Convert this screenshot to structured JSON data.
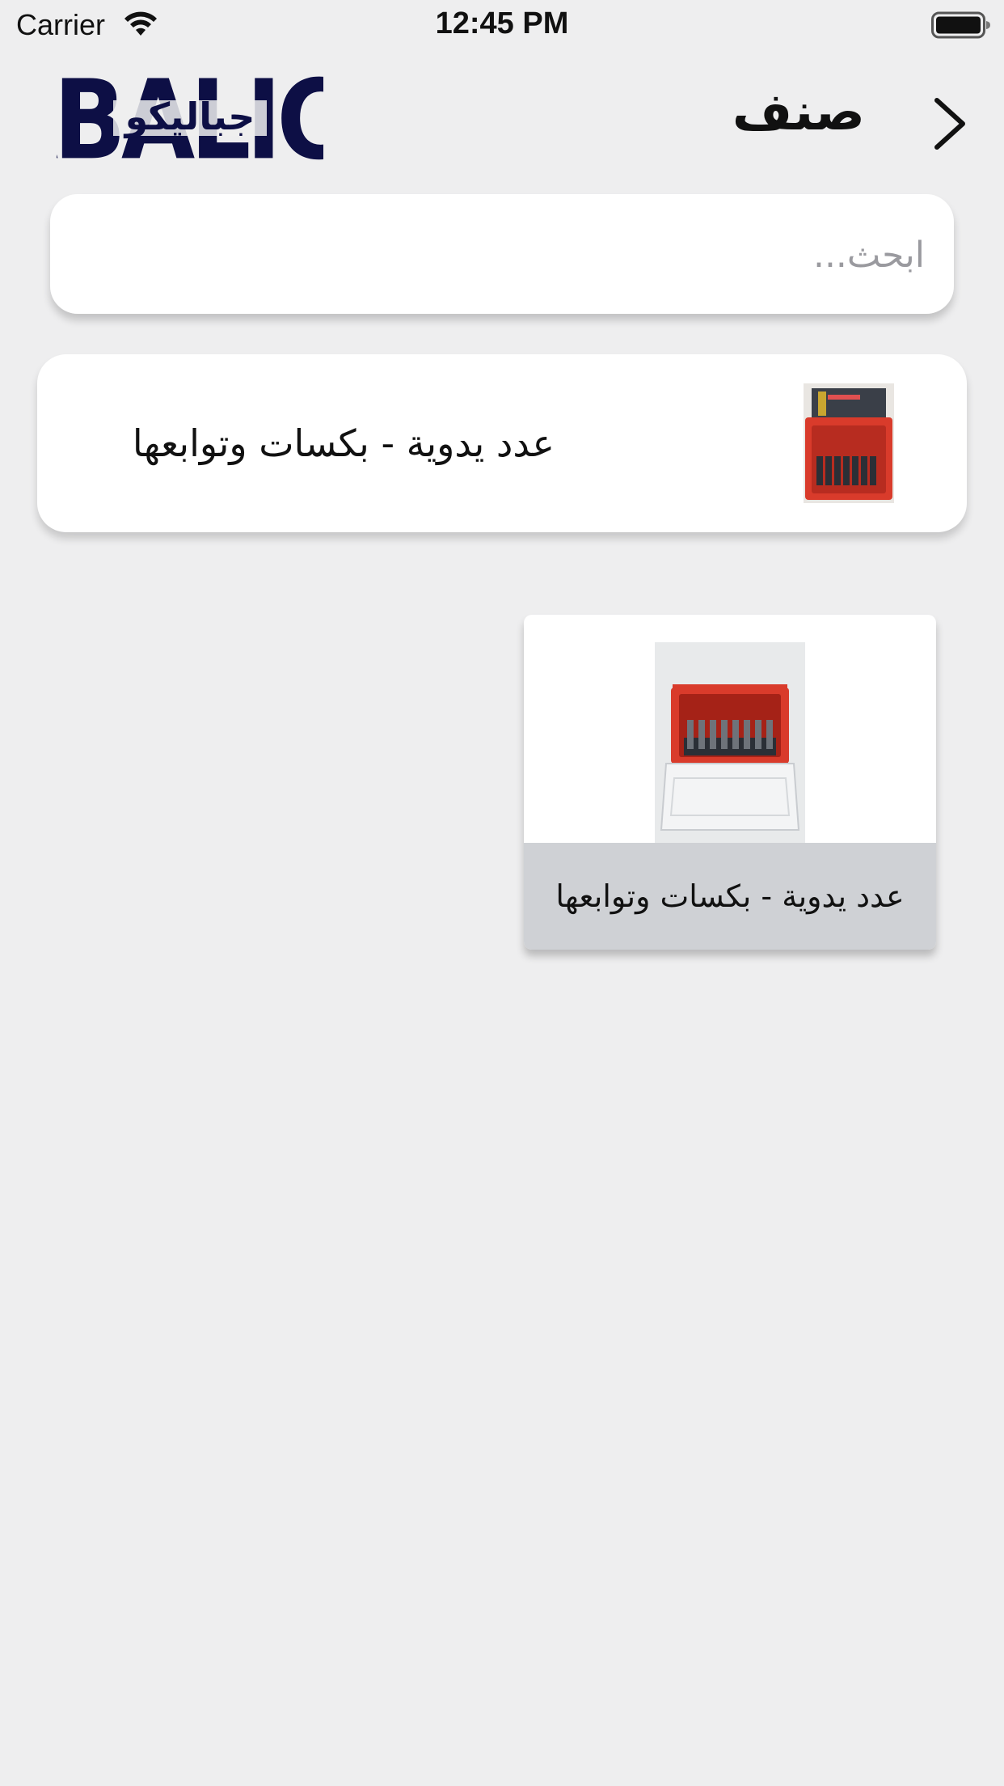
{
  "status_bar": {
    "carrier": "Carrier",
    "time": "12:45 PM",
    "wifi_icon": "wifi-icon",
    "battery_icon": "battery-icon"
  },
  "header": {
    "title": "صنف",
    "logo_text_latin": "JABALICO",
    "logo_text_arabic": "جباليكو",
    "logo_color": "#0d0f45",
    "back_icon": "chevron-right-icon"
  },
  "search": {
    "placeholder": "ابحث...",
    "value": ""
  },
  "category_row": {
    "label": "عدد يدوية - بكسات وتوابعها",
    "thumbnail_icon": "socket-set-case-image"
  },
  "grid_items": [
    {
      "label": "عدد يدوية - بكسات وتوابعها",
      "image_icon": "socket-set-case-image"
    }
  ],
  "colors": {
    "background": "#eeeeef",
    "card": "#ffffff",
    "caption_bar": "#cfd1d5",
    "case_red": "#d93b2b"
  }
}
